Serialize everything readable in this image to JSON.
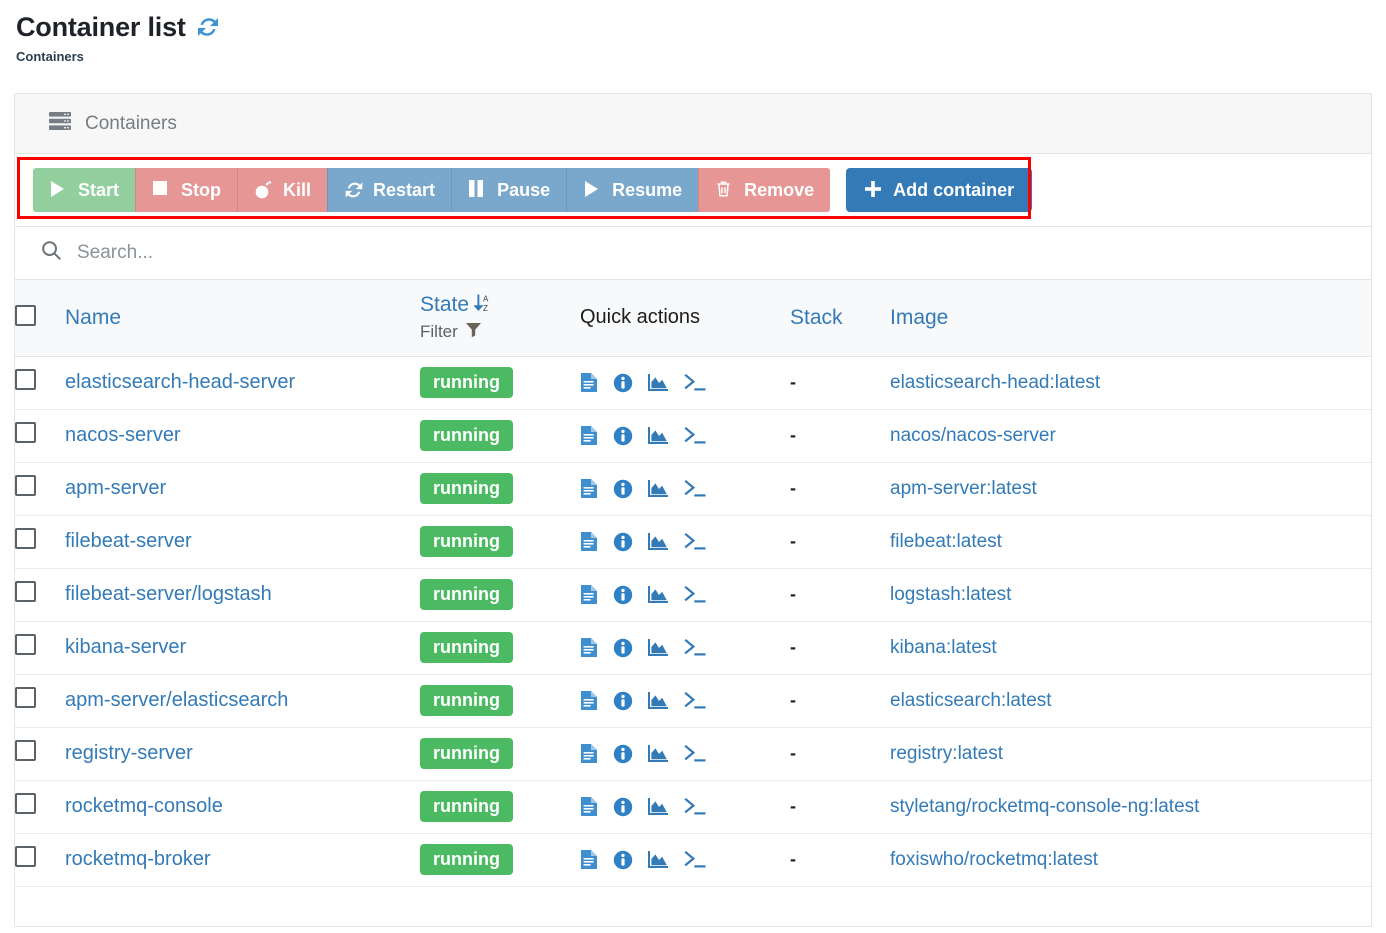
{
  "header": {
    "title": "Container list",
    "refresh_icon": "refresh-icon",
    "breadcrumb": "Containers"
  },
  "panel": {
    "icon": "server-stack-icon",
    "title": "Containers"
  },
  "toolbar": {
    "buttons": [
      {
        "label": "Start",
        "icon": "play-icon",
        "color": "#93ce9f"
      },
      {
        "label": "Stop",
        "icon": "stop-icon",
        "color": "#e59695"
      },
      {
        "label": "Kill",
        "icon": "bomb-icon",
        "color": "#e59695"
      },
      {
        "label": "Restart",
        "icon": "restart-icon",
        "color": "#7aa7cc"
      },
      {
        "label": "Pause",
        "icon": "pause-icon",
        "color": "#7aa7cc"
      },
      {
        "label": "Resume",
        "icon": "play-icon",
        "color": "#7aa7cc"
      },
      {
        "label": "Remove",
        "icon": "trash-icon",
        "color": "#e59695"
      }
    ],
    "add_container": {
      "label": "Add container",
      "icon": "plus-icon",
      "color": "#337ab7"
    },
    "highlight_color": "#ff0000"
  },
  "search": {
    "icon": "search-icon",
    "placeholder": "Search...",
    "value": ""
  },
  "table": {
    "columns": {
      "select_all": "select-all-checkbox",
      "name": "Name",
      "state": "State",
      "state_sort_icon": "sort-alpha-down-icon",
      "filter": "Filter",
      "filter_icon": "funnel-icon",
      "quick_actions": "Quick actions",
      "stack": "Stack",
      "image": "Image"
    },
    "quick_action_icons": [
      "logs-icon",
      "info-icon",
      "stats-icon",
      "console-icon"
    ],
    "rows": [
      {
        "name": "elasticsearch-head-server",
        "state": "running",
        "stack": "-",
        "image": "elasticsearch-head:latest"
      },
      {
        "name": "nacos-server",
        "state": "running",
        "stack": "-",
        "image": "nacos/nacos-server"
      },
      {
        "name": "apm-server",
        "state": "running",
        "stack": "-",
        "image": "apm-server:latest"
      },
      {
        "name": "filebeat-server",
        "state": "running",
        "stack": "-",
        "image": "filebeat:latest"
      },
      {
        "name": "filebeat-server/logstash",
        "state": "running",
        "stack": "-",
        "image": "logstash:latest"
      },
      {
        "name": "kibana-server",
        "state": "running",
        "stack": "-",
        "image": "kibana:latest"
      },
      {
        "name": "apm-server/elasticsearch",
        "state": "running",
        "stack": "-",
        "image": "elasticsearch:latest"
      },
      {
        "name": "registry-server",
        "state": "running",
        "stack": "-",
        "image": "registry:latest"
      },
      {
        "name": "rocketmq-console",
        "state": "running",
        "stack": "-",
        "image": "styletang/rocketmq-console-ng:latest"
      },
      {
        "name": "rocketmq-broker",
        "state": "running",
        "stack": "-",
        "image": "foxiswho/rocketmq:latest"
      }
    ]
  },
  "colors": {
    "link": "#337ab7",
    "badge_running": "#4cb963",
    "panel_border": "#e2e4e6"
  }
}
